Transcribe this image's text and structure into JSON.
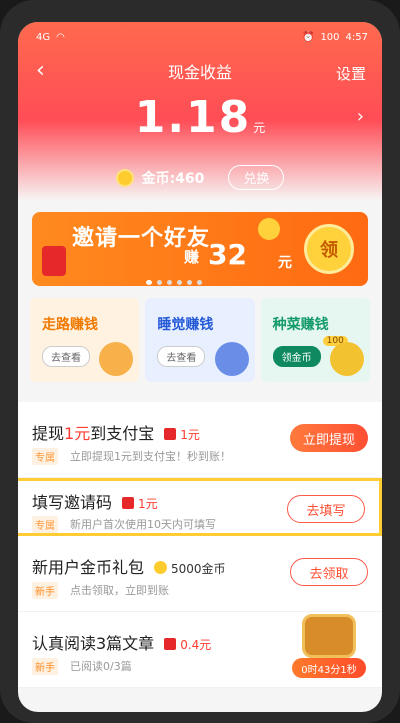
{
  "status_bar": {
    "left_text": "4G",
    "battery": "100",
    "time": "4:57"
  },
  "header": {
    "back_glyph": "‹",
    "title": "现金收益",
    "settings_label": "设置"
  },
  "balance": {
    "amount": "1.18",
    "unit": "元",
    "chevron": "›"
  },
  "coins": {
    "label": "金币:460",
    "exchange_label": "兑换"
  },
  "banner": {
    "title": "邀请一个好友",
    "earn_label": "赚",
    "amount": "32",
    "unit": "元",
    "button_label": "领",
    "dots_count": 6,
    "active_dot": 0
  },
  "tasks": [
    {
      "title": "走路赚钱",
      "button": "去查看"
    },
    {
      "title": "睡觉赚钱",
      "button": "去查看"
    },
    {
      "title": "种菜赚钱",
      "button": "领金币",
      "badge": "100"
    }
  ],
  "list": [
    {
      "title_pre": "提现",
      "title_hl": "1元",
      "title_post": "到支付宝",
      "reward": "1元",
      "tag": "专属",
      "desc": "立即提现1元到支付宝！秒到账！",
      "action": "立即提现"
    },
    {
      "title_pre": "填写邀请码",
      "title_hl": "",
      "title_post": "",
      "reward": "1元",
      "tag": "专属",
      "desc": "新用户首次使用10天内可填写",
      "action": "去填写"
    },
    {
      "title_pre": "新用户金币礼包",
      "title_hl": "",
      "title_post": "",
      "reward": "5000金币",
      "tag": "新手",
      "desc": "点击领取，立即到账",
      "action": "去领取"
    },
    {
      "title_pre": "认真阅读3篇文章",
      "title_hl": "",
      "title_post": "",
      "reward": "0.4元",
      "tag": "新手",
      "desc": "已阅读0/3篇",
      "timer": "0时43分1秒"
    }
  ]
}
